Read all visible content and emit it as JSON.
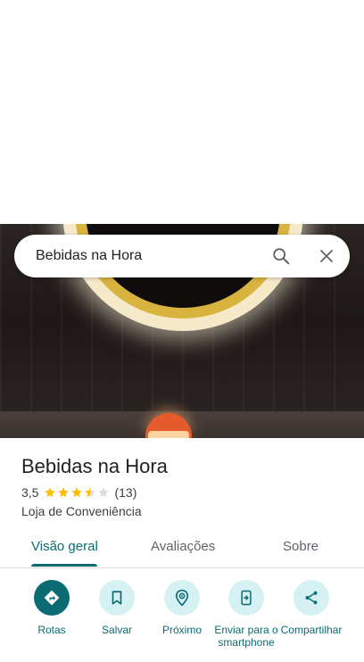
{
  "search": {
    "query": "Bebidas na Hora"
  },
  "place": {
    "name": "Bebidas na Hora",
    "rating": "3,5",
    "rating_value": 3.5,
    "rating_max": 5,
    "review_count": "(13)",
    "category": "Loja de Conveniência"
  },
  "tabs": [
    {
      "label": "Visão geral",
      "active": true
    },
    {
      "label": "Avaliações",
      "active": false
    },
    {
      "label": "Sobre",
      "active": false
    }
  ],
  "actions": [
    {
      "label": "Rotas",
      "icon": "directions-icon"
    },
    {
      "label": "Salvar",
      "icon": "bookmark-icon"
    },
    {
      "label": "Próximo",
      "icon": "nearby-icon"
    },
    {
      "label": "Enviar para o smartphone",
      "icon": "send-to-phone-icon"
    },
    {
      "label": "Compartilhar",
      "icon": "share-icon"
    }
  ],
  "colors": {
    "accent": "#0b6b73",
    "accent_light": "#d5f1f4",
    "star": "#fbbc04",
    "star_empty": "#dadce0"
  }
}
